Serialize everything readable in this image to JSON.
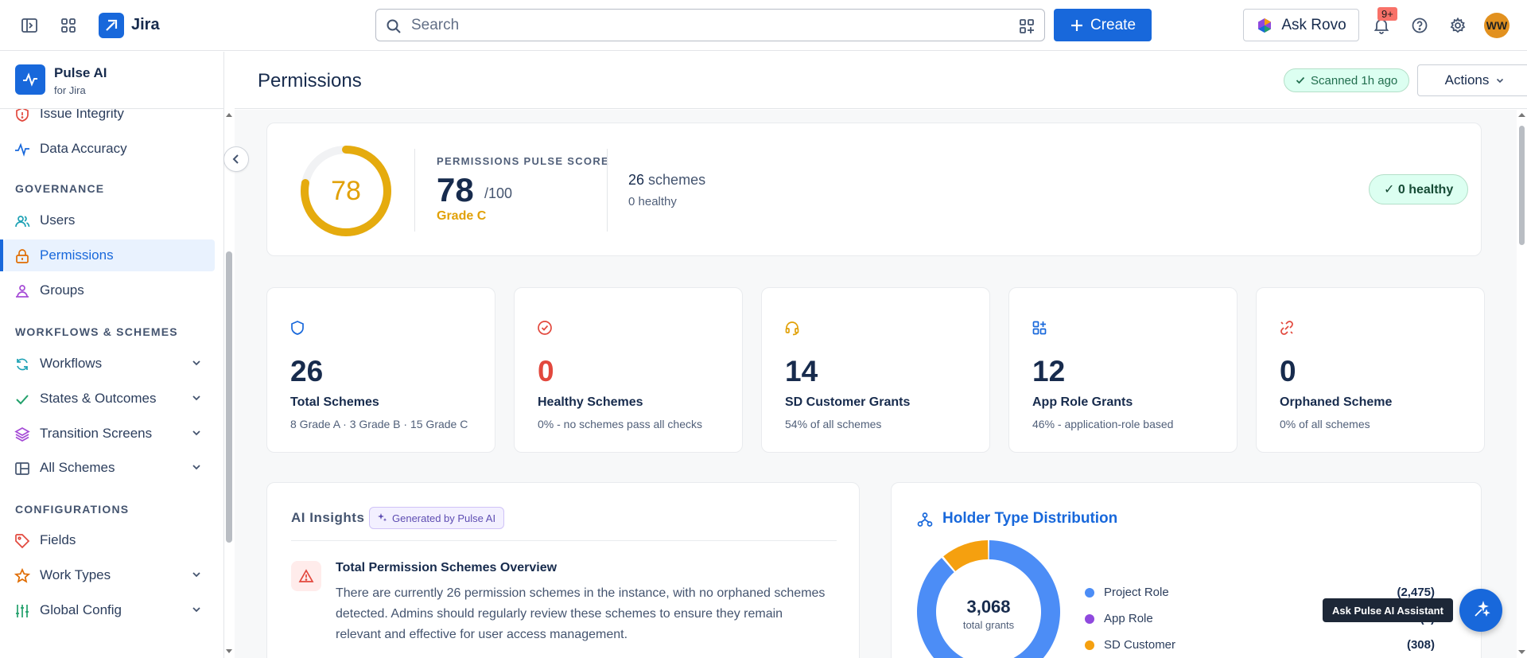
{
  "topbar": {
    "app_name": "Jira",
    "search_placeholder": "Search",
    "create_label": "Create",
    "ask_rovo_label": "Ask Rovo",
    "notification_count": "9+",
    "avatar_initials": "WW",
    "icons": [
      "sidebar-toggle-icon",
      "app-switcher-icon",
      "jira-logo-icon",
      "search-icon",
      "filter-icon",
      "plus-icon",
      "rovo-icon",
      "bell-icon",
      "help-icon",
      "gear-icon"
    ]
  },
  "sidebar": {
    "app_title": "Pulse AI",
    "app_subtitle": "for Jira",
    "items_top": [
      {
        "label": "Issue Integrity",
        "icon": "shield-alert-icon"
      },
      {
        "label": "Data Accuracy",
        "icon": "pulse-icon"
      }
    ],
    "section_governance": "GOVERNANCE",
    "governance": [
      {
        "label": "Users",
        "icon": "users-icon"
      },
      {
        "label": "Permissions",
        "icon": "lock-icon",
        "active": true
      },
      {
        "label": "Groups",
        "icon": "groups-icon"
      }
    ],
    "section_workflows": "WORKFLOWS & SCHEMES",
    "workflows": [
      {
        "label": "Workflows",
        "icon": "refresh-icon"
      },
      {
        "label": "States & Outcomes",
        "icon": "check-icon"
      },
      {
        "label": "Transition Screens",
        "icon": "layers-icon"
      },
      {
        "label": "All Schemes",
        "icon": "layout-icon"
      }
    ],
    "section_config": "CONFIGURATIONS",
    "config": [
      {
        "label": "Fields",
        "icon": "tag-icon"
      },
      {
        "label": "Work Types",
        "icon": "star-icon"
      },
      {
        "label": "Global Config",
        "icon": "sliders-icon"
      }
    ]
  },
  "header": {
    "title": "Permissions",
    "scanned": "Scanned 1h ago",
    "actions_label": "Actions"
  },
  "score": {
    "gauge_value": "78",
    "gauge_fraction": 0.78,
    "label": "PERMISSIONS PULSE SCORE",
    "score": "78",
    "max": "/100",
    "grade": "Grade C",
    "schemes_count": "26",
    "schemes_word": "schemes",
    "healthy_sub": "0 healthy",
    "healthy_pill": "✓ 0 healthy"
  },
  "stats": [
    {
      "value": "26",
      "label": "Total Schemes",
      "sub": "8 Grade A · 3 Grade B · 15 Grade C",
      "icon": "shield-icon",
      "color": "#1868db",
      "value_color": "#172b4d"
    },
    {
      "value": "0",
      "label": "Healthy Schemes",
      "sub": "0% - no schemes pass all checks",
      "icon": "check-circle-icon",
      "color": "#e2483d",
      "value_color": "#e2483d"
    },
    {
      "value": "14",
      "label": "SD Customer Grants",
      "sub": "54% of all schemes",
      "icon": "headset-icon",
      "color": "#e1a108",
      "value_color": "#172b4d"
    },
    {
      "value": "12",
      "label": "App Role Grants",
      "sub": "46% - application-role based",
      "icon": "apps-icon",
      "color": "#1868db",
      "value_color": "#172b4d"
    },
    {
      "value": "0",
      "label": "Orphaned Scheme",
      "sub": "0% of all schemes",
      "icon": "broken-link-icon",
      "color": "#e2483d",
      "value_color": "#172b4d"
    }
  ],
  "insights": {
    "title": "AI Insights",
    "badge": "Generated by Pulse AI",
    "item_title": "Total Permission Schemes Overview",
    "item_body": "There are currently 26 permission schemes in the instance, with no orphaned schemes detected. Admins should regularly review these schemes to ensure they remain relevant and effective for user access management."
  },
  "holder": {
    "title": "Holder Type Distribution",
    "total": "3,068",
    "total_label": "total grants",
    "legend": [
      {
        "label": "Project Role",
        "value": "(2,475)",
        "color": "#4c8df6"
      },
      {
        "label": "App Role",
        "value": "(5)",
        "color": "#8f49de"
      },
      {
        "label": "SD Customer",
        "value": "(308)",
        "color": "#f5a00f"
      }
    ]
  },
  "assistant": {
    "tooltip": "Ask Pulse AI Assistant"
  }
}
